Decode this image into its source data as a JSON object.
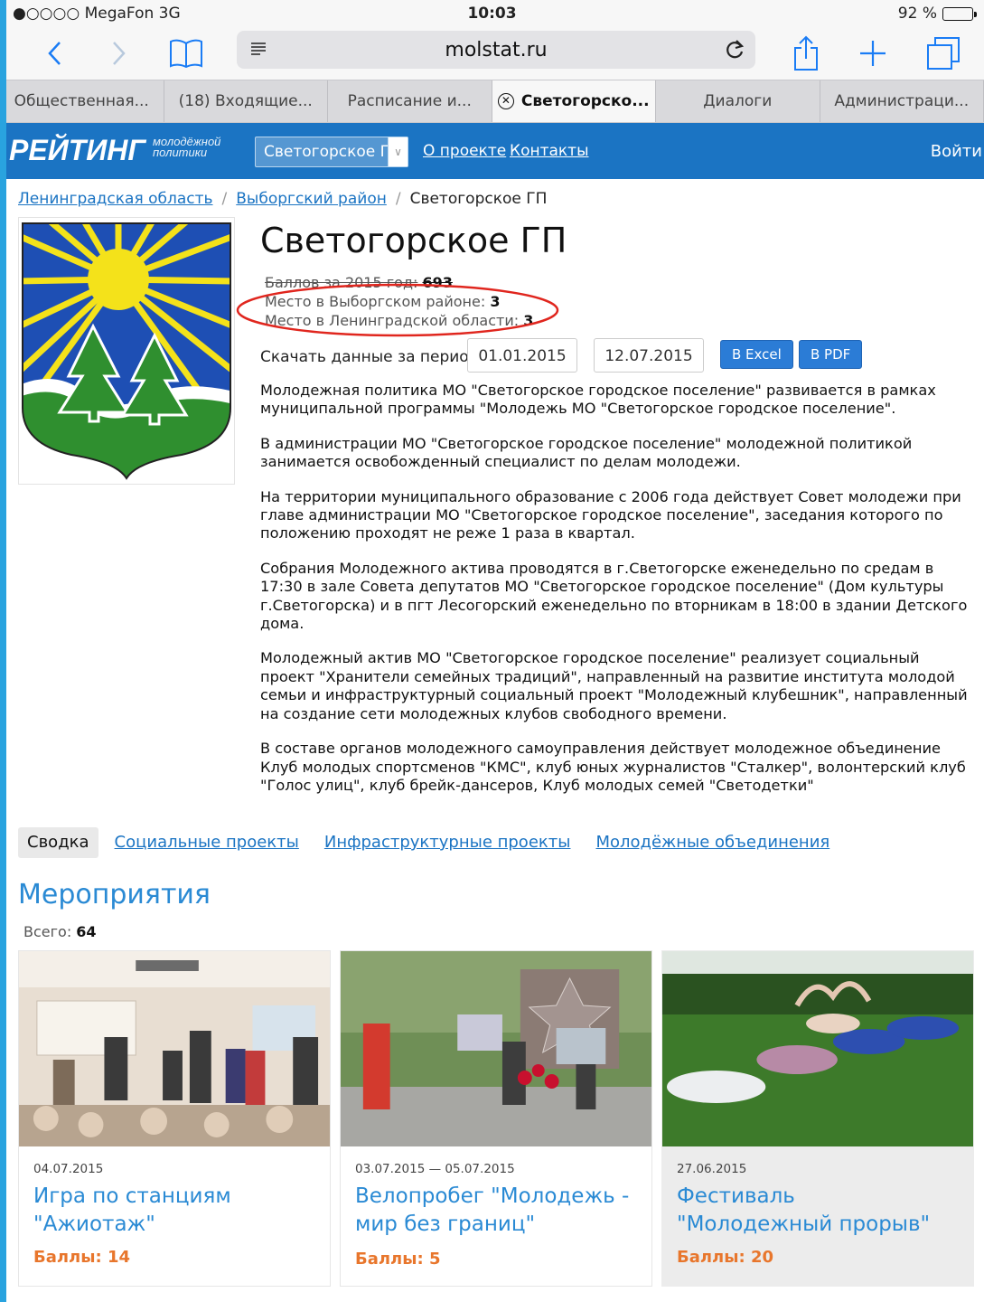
{
  "status_bar": {
    "carrier": "●○○○○ MegaFon  3G",
    "time": "10:03",
    "battery": "92 %",
    "battery_level": 0.92
  },
  "browser": {
    "url": "molstat.ru",
    "tabs": [
      {
        "label": "Общественная..."
      },
      {
        "label": "(18) Входящие..."
      },
      {
        "label": "Расписание и..."
      },
      {
        "label": "Светогорско..."
      },
      {
        "label": "Диалоги"
      },
      {
        "label": "Администраци..."
      }
    ],
    "active_tab": 3,
    "icons": [
      "back-icon",
      "forward-icon",
      "bookmarks-icon",
      "reader-icon",
      "reload-icon",
      "share-icon",
      "new-tab-icon",
      "tabs-icon"
    ]
  },
  "header": {
    "logo_big": "РЕЙТИНГ",
    "logo_small": "молодёжной политики",
    "region_select": "Светогорское ГП",
    "nav": [
      "О проекте",
      "Контакты"
    ],
    "login": "Войти",
    "color": "#1b74c3"
  },
  "breadcrumb": {
    "items": [
      "Ленинградская область",
      "Выборгский район"
    ],
    "current": "Светогорское ГП"
  },
  "main": {
    "title": "Светогорское ГП",
    "stats": {
      "score_label": "Баллов за 2015 год:",
      "score_value": "693",
      "district_label": "Место в Выборгском районе:",
      "district_value": "3",
      "region_label": "Место в Ленинградской области:",
      "region_value": "3"
    },
    "download": {
      "label": "Скачать данные за период:",
      "from": "01.01.2015",
      "to": "12.07.2015",
      "excel": "В Excel",
      "pdf": "В PDF"
    },
    "paragraphs": [
      "Молодежная политика МО \"Светогорское городское поселение\" развивается в рамках муниципальной программы \"Молодежь МО \"Светогорское городское поселение\".",
      "В администрации МО \"Светогорское городское поселение\" молодежной политикой занимается освобожденный специалист по делам молодежи.",
      "На территории муниципального образование с 2006 года действует Совет молодежи при главе администрации МО \"Светогорское городское поселение\", заседания которого по положению проходят не реже 1 раза в квартал.",
      "Собрания Молодежного актива проводятся в г.Светогорске еженедельно по средам в 17:30 в зале Совета депутатов МО  \"Светогорское городское поселение\" (Дом культуры г.Светогорска) и в пгт Лесогорский еженедельно по вторникам в 18:00 в здании Детского дома.",
      "Молодежный актив МО \"Светогорское городское поселение\" реализует социальный проект \"Хранители семейных традиций\", направленный на развитие института молодой семьи и инфраструктурный социальный проект \"Молодежный клубешник\", направленный на создание сети молодежных клубов свободного времени.",
      "В составе органов молодежного самоуправления действует молодежное объединение Клуб молодых спортсменов \"КМС\", клуб юных журналистов \"Сталкер\", волонтерский клуб \"Голос улиц\", клуб брейк-дансеров, Клуб молодых семей \"Светодетки\""
    ]
  },
  "section_tabs": [
    "Сводка",
    "Социальные проекты",
    "Инфраструктурные проекты",
    "Молодёжные объединения"
  ],
  "events": {
    "title": "Мероприятия",
    "total_label": "Всего:",
    "total_value": "64",
    "cards": [
      {
        "date": "04.07.2015",
        "name": "Игра по станциям \"Ажиотаж\"",
        "score_label": "Баллы:",
        "score": "14"
      },
      {
        "date": "03.07.2015 — 05.07.2015",
        "name": "Велопробег \"Молодежь - мир без границ\"",
        "score_label": "Баллы:",
        "score": "5"
      },
      {
        "date": "27.06.2015",
        "name": "Фестиваль \"Молодежный прорыв\"",
        "score_label": "Баллы:",
        "score": "20"
      }
    ]
  },
  "colors": {
    "accent": "#1b74c3",
    "link": "#2a8ad4",
    "score": "#e8762c",
    "annotation": "#e0261e"
  }
}
